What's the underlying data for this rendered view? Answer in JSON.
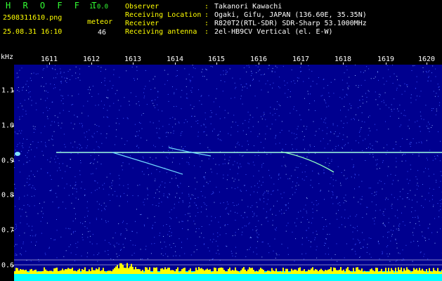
{
  "header": {
    "app_name": "H R O F F T",
    "version": "1.0.0",
    "filename": "2508311610.png",
    "datetime": "25.08.31 16:10",
    "meteor_label": "meteor",
    "meteor_count": "46",
    "info": [
      {
        "label": "Observer",
        "value": "Takanori Kawachi"
      },
      {
        "label": "Receiving Location",
        "value": "Ogaki, Gifu, JAPAN (136.60E, 35.35N)"
      },
      {
        "label": "Receiver",
        "value": "R820T2(RTL-SDR) SDR-Sharp 53.1000MHz"
      },
      {
        "label": "Receiving antenna",
        "value": "2el-HB9CV Vertical (el. E-W)"
      }
    ]
  },
  "axes": {
    "y_unit": "kHz",
    "x_ticks": [
      "1611",
      "1612",
      "1613",
      "1614",
      "1615",
      "1616",
      "1617",
      "1618",
      "1619",
      "1620"
    ],
    "y_ticks": [
      "1.1",
      "1.0",
      "0.9",
      "0.8",
      "0.7",
      "0.6"
    ]
  },
  "colors": {
    "background": "#000000",
    "spectrogram": "#00008f",
    "header_text": "#ffff00",
    "title_text": "#33ff33",
    "signal": "#9fffe0",
    "level_yellow": "#ffff00",
    "level_cyan": "#00ffff"
  }
}
